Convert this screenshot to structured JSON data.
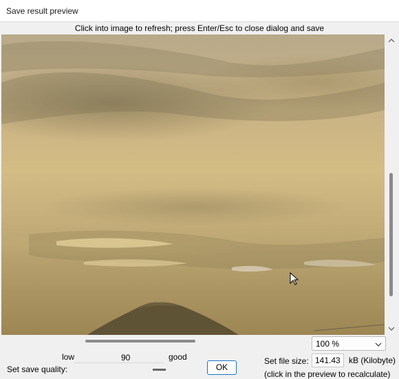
{
  "window": {
    "title": "Save result preview"
  },
  "hint": "Click into image to refresh; press Enter/Esc to close dialog and save",
  "zoom": {
    "selected": "100 %"
  },
  "quality": {
    "low_label": "low",
    "value": "90",
    "good_label": "good",
    "set_label": "Set save quality:"
  },
  "ok_button": "OK",
  "file_size": {
    "label": "Set file size:",
    "value": "141.43",
    "unit": "kB (Kilobyte)",
    "note": "(click in the preview to recalculate)"
  },
  "icons": {
    "scroll_up": "chevron-up-icon",
    "scroll_down": "chevron-down-icon",
    "dropdown": "chevron-down-icon",
    "cursor": "mouse-pointer-icon"
  }
}
